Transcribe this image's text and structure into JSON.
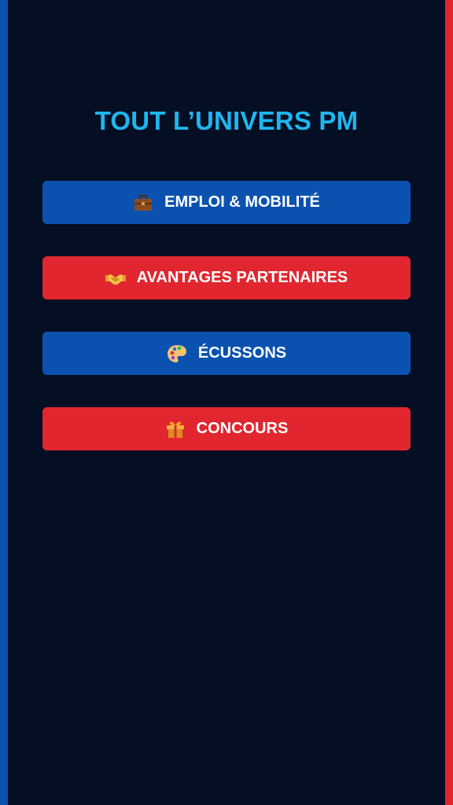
{
  "page": {
    "title": "TOUT L’UNIVERS PM"
  },
  "colors": {
    "background": "#040f24",
    "title": "#1fb6ef",
    "blue_button": "#0b52b0",
    "red_button": "#e1262f",
    "left_edge": "#0b52b0",
    "right_edge": "#e1262f"
  },
  "menu": {
    "items": [
      {
        "label": "EMPLOI & MOBILITÉ",
        "icon": "briefcase-icon",
        "color": "blue"
      },
      {
        "label": "AVANTAGES PARTENAIRES",
        "icon": "handshake-icon",
        "color": "red"
      },
      {
        "label": "ÉCUSSONS",
        "icon": "palette-icon",
        "color": "blue"
      },
      {
        "label": "CONCOURS",
        "icon": "gift-icon",
        "color": "red"
      }
    ]
  }
}
